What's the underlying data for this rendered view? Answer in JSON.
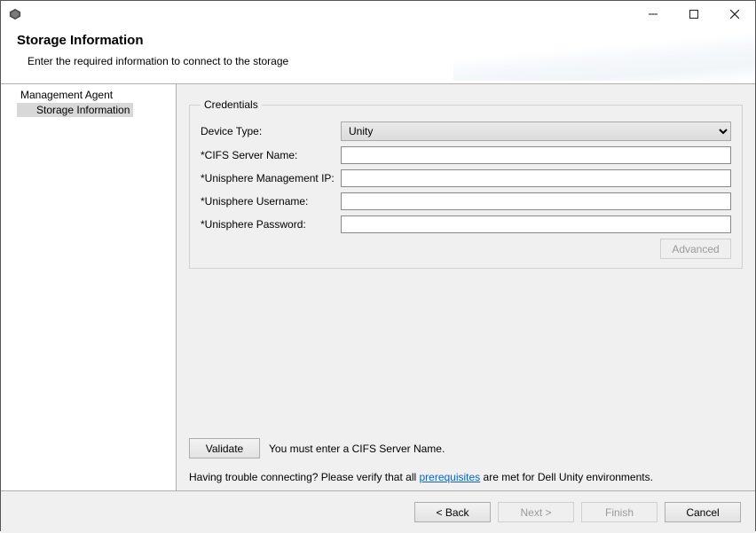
{
  "header": {
    "title": "Storage Information",
    "subtitle": "Enter the required information to connect to the storage"
  },
  "sidebar": {
    "items": [
      {
        "label": "Management Agent",
        "selected": false
      },
      {
        "label": "Storage Information",
        "selected": true
      }
    ]
  },
  "credentials": {
    "legend": "Credentials",
    "device_type_label": "Device Type:",
    "device_type_value": "Unity",
    "cifs_label": "*CIFS Server Name:",
    "cifs_value": "",
    "mgmt_ip_label": "*Unisphere Management IP:",
    "mgmt_ip_value": "",
    "username_label": "*Unisphere Username:",
    "username_value": "",
    "password_label": "*Unisphere Password:",
    "password_value": "",
    "advanced_label": "Advanced"
  },
  "validate": {
    "button_label": "Validate",
    "message": "You must enter a CIFS Server Name."
  },
  "help": {
    "prefix": "Having trouble connecting? Please verify that all ",
    "link_text": "prerequisites",
    "suffix": " are met for Dell Unity environments."
  },
  "footer": {
    "back": "< Back",
    "next": "Next >",
    "finish": "Finish",
    "cancel": "Cancel"
  }
}
